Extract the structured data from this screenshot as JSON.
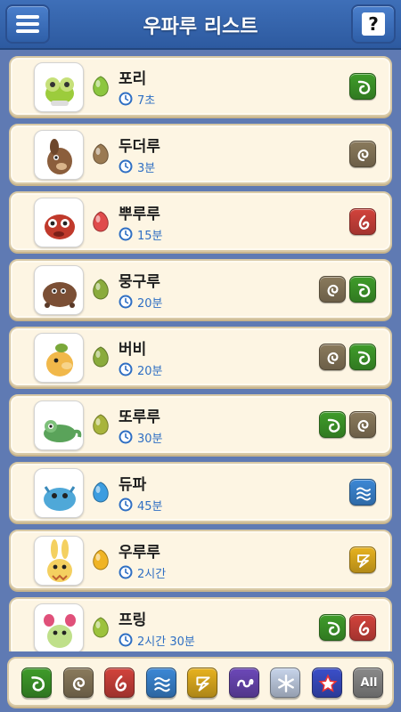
{
  "header": {
    "title": "우파루 리스트",
    "help_label": "?"
  },
  "type_colors": {
    "forest": "#3f9c2a",
    "earth": "#8a7a5c",
    "fire": "#d2433c",
    "water": "#3c88d6",
    "thunder": "#e7b21f",
    "wind": "#6c48b8",
    "ice": "#c7d4ea",
    "rainbow": "#3b4fc9",
    "all": "#8a8a8a"
  },
  "wooparoos": [
    {
      "name": "포리",
      "time": "7초",
      "types": [
        "forest"
      ],
      "seed_color": "#8cc63f",
      "icon": "pori-icon"
    },
    {
      "name": "두더루",
      "time": "3분",
      "types": [
        "earth"
      ],
      "seed_color": "#9a7a52",
      "icon": "dudeoru-icon"
    },
    {
      "name": "뿌루루",
      "time": "15분",
      "types": [
        "fire"
      ],
      "seed_color": "#e04b4b",
      "icon": "ppururu-icon"
    },
    {
      "name": "뭉구루",
      "time": "20분",
      "types": [
        "earth",
        "forest"
      ],
      "seed_color": "#8aab3c",
      "icon": "munguru-icon"
    },
    {
      "name": "버비",
      "time": "20분",
      "types": [
        "earth",
        "forest"
      ],
      "seed_color": "#8aab3c",
      "icon": "beobi-icon"
    },
    {
      "name": "또루루",
      "time": "30분",
      "types": [
        "forest",
        "earth"
      ],
      "seed_color": "#a8b43c",
      "icon": "ttoruru-icon"
    },
    {
      "name": "듀파",
      "time": "45분",
      "types": [
        "water"
      ],
      "seed_color": "#3c9de0",
      "icon": "dyupa-icon"
    },
    {
      "name": "우루루",
      "time": "2시간",
      "types": [
        "thunder"
      ],
      "seed_color": "#f0b424",
      "icon": "ururu-icon"
    },
    {
      "name": "프링",
      "time": "2시간 30분",
      "types": [
        "forest",
        "fire"
      ],
      "seed_color": "#9cc23c",
      "icon": "peuring-icon"
    }
  ],
  "filters": [
    {
      "type": "forest",
      "label": ""
    },
    {
      "type": "earth",
      "label": ""
    },
    {
      "type": "fire",
      "label": ""
    },
    {
      "type": "water",
      "label": ""
    },
    {
      "type": "thunder",
      "label": ""
    },
    {
      "type": "wind",
      "label": ""
    },
    {
      "type": "ice",
      "label": ""
    },
    {
      "type": "rainbow",
      "label": ""
    },
    {
      "type": "all",
      "label": "All"
    }
  ]
}
